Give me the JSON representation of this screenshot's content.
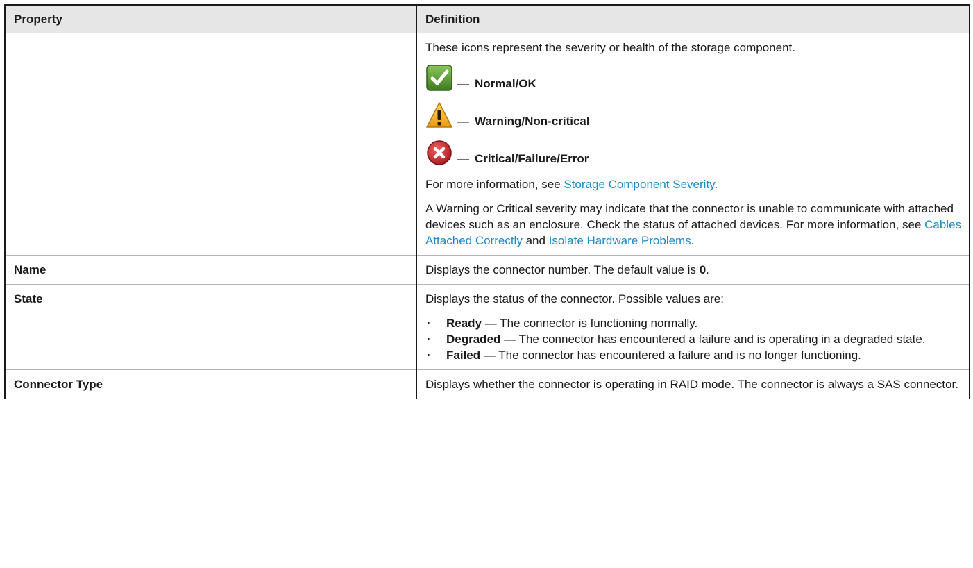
{
  "table": {
    "header_property": "Property",
    "header_definition": "Definition"
  },
  "severity_row": {
    "intro": "These icons represent the severity or health of the storage component.",
    "separator": "—",
    "items": [
      {
        "icon": "ok-check-icon",
        "label": "Normal/OK",
        "color": "#4e8a2e"
      },
      {
        "icon": "warning-triangle-icon",
        "label": "Warning/Non-critical",
        "color": "#f2b32e"
      },
      {
        "icon": "critical-x-icon",
        "label": "Critical/Failure/Error",
        "color": "#c8282c"
      }
    ],
    "more_info_prefix": "For more information, see",
    "more_info_link": "Storage Component Severity",
    "more_info_suffix": ".",
    "warning_text": "A Warning or Critical severity may indicate that the connector is unable to communicate with attached devices such as an enclosure. Check the status of attached devices. For more information, see",
    "link_cables": "Cables Attached Correctly",
    "and_text": "and",
    "link_isolate": "Isolate Hardware Problems",
    "end_period": "."
  },
  "name_row": {
    "property": "Name",
    "definition_prefix": "Displays the connector number. The default value is",
    "default_value": "0",
    "definition_suffix": "."
  },
  "state_row": {
    "property": "State",
    "intro": "Displays the status of the connector. Possible values are:",
    "values": [
      {
        "term": "Ready",
        "desc": "— The connector is functioning normally."
      },
      {
        "term": "Degraded",
        "desc": "— The connector has encountered a failure and is operating in a degraded state."
      },
      {
        "term": "Failed",
        "desc": "— The connector has encountered a failure and is no longer functioning."
      }
    ]
  },
  "connector_type_row": {
    "property": "Connector Type",
    "definition": "Displays whether the connector is operating in RAID mode. The connector is always a SAS connector."
  },
  "colors": {
    "link": "#1b8ac7",
    "header_bg": "#e6e6e6"
  }
}
